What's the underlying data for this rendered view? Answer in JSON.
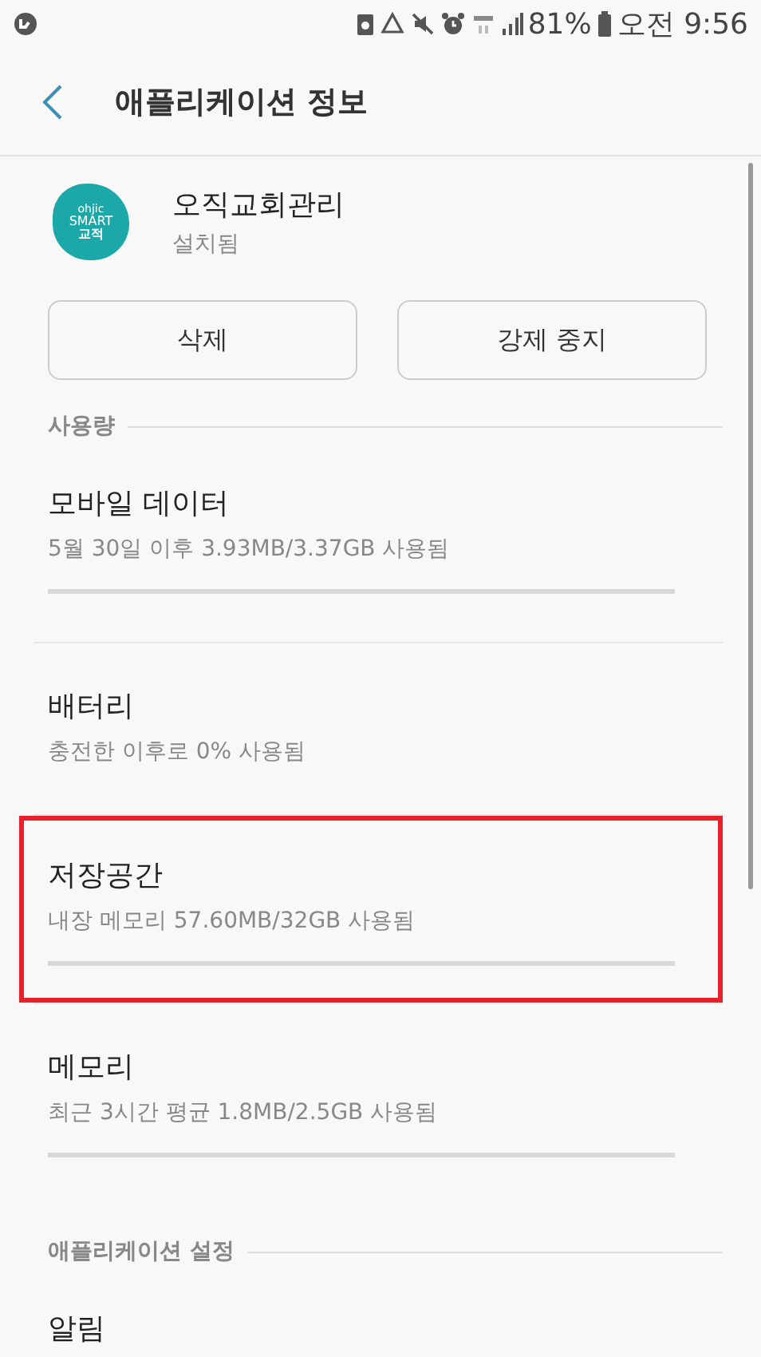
{
  "status_bar": {
    "battery_percent": "81%",
    "time": "오전 9:56"
  },
  "header": {
    "title": "애플리케이션 정보"
  },
  "app": {
    "logo_lines": [
      "ohjic",
      "SMART",
      "교적"
    ],
    "name": "오직교회관리",
    "status": "설치됨"
  },
  "buttons": [
    {
      "label": "삭제"
    },
    {
      "label": "강제 중지"
    }
  ],
  "sections": [
    {
      "title": "사용량",
      "items": [
        {
          "kind": "bar",
          "title": "모바일 데이터",
          "detail": "5월 30일 이후 3.93MB/3.37GB 사용됨",
          "level": 0,
          "highlighted": false
        },
        {
          "kind": "plain",
          "title": "배터리",
          "detail": "충전한 이후로 0% 사용됨",
          "highlighted": false
        },
        {
          "kind": "bar",
          "title": "저장공간",
          "detail": "내장 메모리 57.60MB/32GB 사용됨",
          "level": 0,
          "highlighted": true
        },
        {
          "kind": "bar",
          "title": "메모리",
          "detail": "최근 3시간 평균 1.8MB/2.5GB 사용됨",
          "level": 0,
          "highlighted": false
        }
      ]
    },
    {
      "title": "애플리케이션 설정",
      "items": [
        {
          "kind": "plain",
          "title": "알림"
        }
      ]
    }
  ]
}
